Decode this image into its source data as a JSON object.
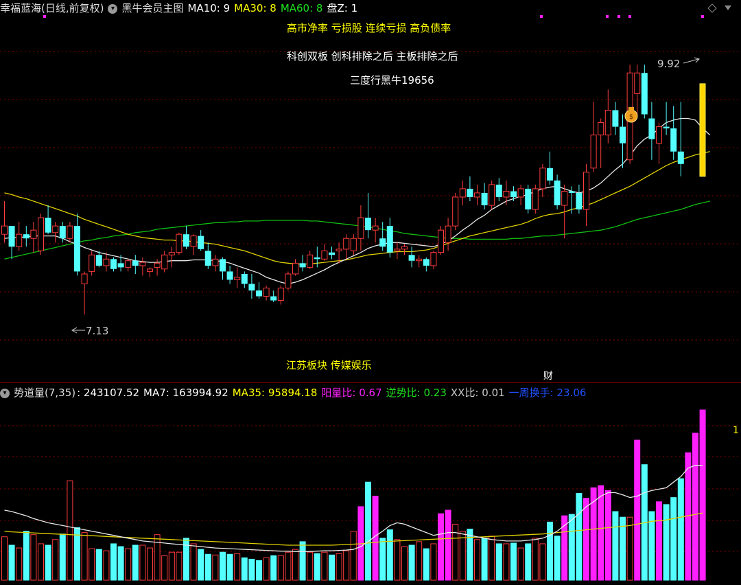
{
  "header_main": {
    "title": "幸福蓝海(日线,前复权)",
    "indicator_name": "黑牛会员主图",
    "ma10": "MA10: 9",
    "ma30": "MA30: 8",
    "ma60": "MA60: 8",
    "panz": "盘Z: 1"
  },
  "header_vol": {
    "title": "势道量(7,35)",
    "value": ": 243107.52",
    "ma7": "MA7: 163994.92",
    "ma35": "MA35: 95894.18",
    "yang": "阳量比: 0.67",
    "nishi": "逆势比: 0.23",
    "xx": "XX比: 0.01",
    "turnover": "一周换手: 23.06"
  },
  "annotations": {
    "line1": "高市净率 亏损股 连续亏损 高负债率",
    "line2": "科创双板 创科排除之后 主板排除之后",
    "line3": "三度行黑牛19656",
    "sector": "江苏板块 传媒娱乐",
    "cai": "财",
    "high_label": "9.92",
    "low_label": "7.13",
    "vol_axis": "1"
  },
  "colors": {
    "up": "#ff3c3c",
    "down": "#54ffff",
    "ma_white": "#e8e8e8",
    "ma_yellow": "#e0d000",
    "ma_green": "#10c010",
    "vol_magenta": "#ff20ff",
    "grid": "#8a0000",
    "highlight": "#ffd700"
  },
  "icons": [
    "chevron-down-icon",
    "money-bag-icon",
    "diamond-icon"
  ],
  "chart_data": [
    {
      "type": "candlestick",
      "title": "幸福蓝海(日线,前复权)",
      "ylim": [
        6.35,
        10.6
      ],
      "candles": [
        [
          8.1,
          8.5,
          8.0,
          8.2
        ],
        [
          8.2,
          8.2,
          7.8,
          7.95
        ],
        [
          7.95,
          8.25,
          7.9,
          8.1
        ],
        [
          8.1,
          8.2,
          7.95,
          8.05
        ],
        [
          8.05,
          8.25,
          7.88,
          8.15
        ],
        [
          7.9,
          8.35,
          7.85,
          8.3
        ],
        [
          8.3,
          8.45,
          8.1,
          8.12
        ],
        [
          8.12,
          8.25,
          8.0,
          8.2
        ],
        [
          8.2,
          8.25,
          8.0,
          8.05
        ],
        [
          8.05,
          8.25,
          8.0,
          8.2
        ],
        [
          8.2,
          8.35,
          7.6,
          7.65
        ],
        [
          7.5,
          7.65,
          7.13,
          7.62
        ],
        [
          7.65,
          7.9,
          7.6,
          7.85
        ],
        [
          7.85,
          7.9,
          7.7,
          7.72
        ],
        [
          7.72,
          7.88,
          7.65,
          7.8
        ],
        [
          7.8,
          7.82,
          7.65,
          7.68
        ],
        [
          7.75,
          7.85,
          7.65,
          7.7
        ],
        [
          7.7,
          7.8,
          7.65,
          7.78
        ],
        [
          7.78,
          7.85,
          7.62,
          7.72
        ],
        [
          7.72,
          7.82,
          7.6,
          7.76
        ],
        [
          7.65,
          7.7,
          7.58,
          7.68
        ],
        [
          7.7,
          7.8,
          7.6,
          7.75
        ],
        [
          7.68,
          7.9,
          7.64,
          7.85
        ],
        [
          7.85,
          7.95,
          7.7,
          7.88
        ],
        [
          7.88,
          8.12,
          7.85,
          8.1
        ],
        [
          8.1,
          8.2,
          7.92,
          7.95
        ],
        [
          7.95,
          8.1,
          7.85,
          8.08
        ],
        [
          8.08,
          8.15,
          7.9,
          7.92
        ],
        [
          7.9,
          8.0,
          7.68,
          7.72
        ],
        [
          7.72,
          7.85,
          7.65,
          7.8
        ],
        [
          7.8,
          7.82,
          7.55,
          7.65
        ],
        [
          7.65,
          7.72,
          7.5,
          7.55
        ],
        [
          7.55,
          7.7,
          7.45,
          7.58
        ],
        [
          7.62,
          7.65,
          7.45,
          7.5
        ],
        [
          7.5,
          7.62,
          7.32,
          7.42
        ],
        [
          7.42,
          7.52,
          7.32,
          7.35
        ],
        [
          7.35,
          7.48,
          7.3,
          7.45
        ],
        [
          7.35,
          7.42,
          7.28,
          7.3
        ],
        [
          7.3,
          7.48,
          7.25,
          7.45
        ],
        [
          7.45,
          7.65,
          7.42,
          7.62
        ],
        [
          7.62,
          7.8,
          7.6,
          7.75
        ],
        [
          7.75,
          7.85,
          7.65,
          7.7
        ],
        [
          7.7,
          7.9,
          7.68,
          7.85
        ],
        [
          7.82,
          7.95,
          7.7,
          7.8
        ],
        [
          7.8,
          7.98,
          7.78,
          7.9
        ],
        [
          7.88,
          7.95,
          7.8,
          7.85
        ],
        [
          7.9,
          8.0,
          7.75,
          7.92
        ],
        [
          7.92,
          8.1,
          7.8,
          8.05
        ],
        [
          7.9,
          8.1,
          7.85,
          8.05
        ],
        [
          8.05,
          8.45,
          7.9,
          8.3
        ],
        [
          8.3,
          8.6,
          8.05,
          8.15
        ],
        [
          8.15,
          8.3,
          8.0,
          8.2
        ],
        [
          8.05,
          8.25,
          7.9,
          7.95
        ],
        [
          8.2,
          8.3,
          7.82,
          7.88
        ],
        [
          7.9,
          8.0,
          7.8,
          7.92
        ],
        [
          7.92,
          7.98,
          7.85,
          7.95
        ],
        [
          7.85,
          7.95,
          7.7,
          7.78
        ],
        [
          7.78,
          7.85,
          7.7,
          7.8
        ],
        [
          7.8,
          7.82,
          7.65,
          7.72
        ],
        [
          7.72,
          7.9,
          7.68,
          7.88
        ],
        [
          7.88,
          8.2,
          7.85,
          8.15
        ],
        [
          8.0,
          8.3,
          7.9,
          8.2
        ],
        [
          8.2,
          8.6,
          8.15,
          8.55
        ],
        [
          8.55,
          8.75,
          8.45,
          8.65
        ],
        [
          8.65,
          8.8,
          8.5,
          8.55
        ],
        [
          8.55,
          8.7,
          8.45,
          8.6
        ],
        [
          8.6,
          8.72,
          8.4,
          8.45
        ],
        [
          8.45,
          8.75,
          8.4,
          8.7
        ],
        [
          8.7,
          8.78,
          8.5,
          8.55
        ],
        [
          8.55,
          8.75,
          8.45,
          8.62
        ],
        [
          8.62,
          8.68,
          8.5,
          8.55
        ],
        [
          8.55,
          8.7,
          8.45,
          8.65
        ],
        [
          8.65,
          8.7,
          8.35,
          8.4
        ],
        [
          8.4,
          8.7,
          8.35,
          8.65
        ],
        [
          8.65,
          8.95,
          8.55,
          8.9
        ],
        [
          8.9,
          9.1,
          8.7,
          8.75
        ],
        [
          8.75,
          8.82,
          8.4,
          8.45
        ],
        [
          8.45,
          8.7,
          8.05,
          8.62
        ],
        [
          8.62,
          8.68,
          8.35,
          8.6
        ],
        [
          8.6,
          8.7,
          8.35,
          8.4
        ],
        [
          8.4,
          8.95,
          8.2,
          8.85
        ],
        [
          8.9,
          9.7,
          8.85,
          9.3
        ],
        [
          9.3,
          9.5,
          8.9,
          9.45
        ],
        [
          9.3,
          9.85,
          9.2,
          9.6
        ],
        [
          9.6,
          9.7,
          9.3,
          9.4
        ],
        [
          9.4,
          9.55,
          8.9,
          9.2
        ],
        [
          9.0,
          10.15,
          8.95,
          10.05
        ],
        [
          9.8,
          10.15,
          9.5,
          10.05
        ],
        [
          10.05,
          10.15,
          9.5,
          9.55
        ],
        [
          9.5,
          9.7,
          9.0,
          9.25
        ],
        [
          9.2,
          9.45,
          8.95,
          9.4
        ],
        [
          9.4,
          9.7,
          9.3,
          9.38
        ],
        [
          9.38,
          9.65,
          9.0,
          9.1
        ],
        [
          9.1,
          9.7,
          8.8,
          8.95
        ]
      ],
      "ma10": [
        8.05,
        8.06,
        8.06,
        8.07,
        8.08,
        8.08,
        8.08,
        8.08,
        8.05,
        8.01,
        7.98,
        7.94,
        7.91,
        7.88,
        7.86,
        7.84,
        7.82,
        7.8,
        7.78,
        7.77,
        7.76,
        7.76,
        7.77,
        7.78,
        7.78,
        7.78,
        7.79,
        7.79,
        7.79,
        7.78,
        7.77,
        7.75,
        7.72,
        7.69,
        7.66,
        7.63,
        7.58,
        7.55,
        7.52,
        7.5,
        7.52,
        7.55,
        7.59,
        7.63,
        7.67,
        7.72,
        7.76,
        7.8,
        7.84,
        7.88,
        7.93,
        7.96,
        7.98,
        8.0,
        8.0,
        7.99,
        7.98,
        7.97,
        7.96,
        7.95,
        7.98,
        8.02,
        8.08,
        8.15,
        8.21,
        8.28,
        8.33,
        8.4,
        8.45,
        8.5,
        8.53,
        8.56,
        8.58,
        8.62,
        8.65,
        8.67,
        8.68,
        8.65,
        8.62,
        8.6,
        8.62,
        8.66,
        8.72,
        8.8,
        8.88,
        8.95,
        9.05,
        9.17,
        9.25,
        9.3,
        9.38,
        9.45,
        9.48,
        9.5,
        9.5,
        9.48,
        9.38,
        9.3
      ],
      "ma30": [
        8.6,
        8.58,
        8.55,
        8.53,
        8.5,
        8.47,
        8.44,
        8.41,
        8.38,
        8.35,
        8.32,
        8.28,
        8.25,
        8.22,
        8.19,
        8.16,
        8.13,
        8.1,
        8.08,
        8.06,
        8.05,
        8.04,
        8.03,
        8.03,
        8.02,
        8.02,
        8.01,
        8.0,
        7.99,
        7.98,
        7.96,
        7.94,
        7.92,
        7.9,
        7.87,
        7.84,
        7.81,
        7.78,
        7.76,
        7.75,
        7.74,
        7.74,
        7.74,
        7.75,
        7.76,
        7.77,
        7.78,
        7.79,
        7.81,
        7.83,
        7.85,
        7.86,
        7.87,
        7.88,
        7.89,
        7.89,
        7.89,
        7.9,
        7.91,
        7.93,
        7.96,
        7.99,
        8.02,
        8.05,
        8.08,
        8.1,
        8.12,
        8.14,
        8.16,
        8.18,
        8.2,
        8.22,
        8.25,
        8.29,
        8.32,
        8.34,
        8.35,
        8.37,
        8.4,
        8.42,
        8.45,
        8.48,
        8.52,
        8.56,
        8.6,
        8.64,
        8.68,
        8.73,
        8.78,
        8.83,
        8.88,
        8.93,
        8.97,
        9.0,
        9.03,
        9.06,
        9.08,
        9.1
      ],
      "ma60": [
        7.8,
        7.82,
        7.84,
        7.86,
        7.88,
        7.9,
        7.92,
        7.94,
        7.96,
        7.98,
        8.0,
        8.02,
        8.03,
        8.05,
        8.06,
        8.08,
        8.09,
        8.1,
        8.12,
        8.13,
        8.14,
        8.16,
        8.17,
        8.18,
        8.19,
        8.2,
        8.21,
        8.22,
        8.23,
        8.24,
        8.24,
        8.25,
        8.25,
        8.26,
        8.26,
        8.26,
        8.27,
        8.27,
        8.27,
        8.27,
        8.27,
        8.27,
        8.26,
        8.26,
        8.25,
        8.24,
        8.23,
        8.22,
        8.21,
        8.2,
        8.19,
        8.17,
        8.16,
        8.14,
        8.13,
        8.11,
        8.1,
        8.09,
        8.08,
        8.07,
        8.06,
        8.05,
        8.05,
        8.05,
        8.04,
        8.04,
        8.04,
        8.04,
        8.04,
        8.04,
        8.05,
        8.05,
        8.06,
        8.07,
        8.08,
        8.08,
        8.09,
        8.1,
        8.11,
        8.12,
        8.13,
        8.14,
        8.15,
        8.17,
        8.19,
        8.22,
        8.25,
        8.28,
        8.3,
        8.32,
        8.34,
        8.36,
        8.38,
        8.4,
        8.43,
        8.46,
        8.48,
        8.5
      ],
      "high_marker": 9.92,
      "low_marker": 7.13
    },
    {
      "type": "bar",
      "title": "势道量(7,35)",
      "ylim": [
        0,
        250000
      ],
      "values": [
        62000,
        50000,
        46000,
        70000,
        65000,
        52000,
        50000,
        58000,
        66000,
        142000,
        75000,
        68000,
        45000,
        44000,
        42000,
        52000,
        48000,
        45000,
        50000,
        50000,
        46000,
        65000,
        35000,
        40000,
        40000,
        60000,
        52000,
        44000,
        37000,
        36000,
        40000,
        37000,
        38000,
        32000,
        30000,
        28000,
        32000,
        35000,
        35000,
        40000,
        44000,
        55000,
        40000,
        38000,
        40000,
        36000,
        38000,
        42000,
        70000,
        105000,
        140000,
        120000,
        60000,
        72000,
        58000,
        48000,
        50000,
        55000,
        45000,
        52000,
        95000,
        100000,
        80000,
        70000,
        73000,
        58000,
        60000,
        63000,
        52000,
        52000,
        53000,
        46000,
        52000,
        60000,
        52000,
        83000,
        63000,
        92000,
        94000,
        124000,
        117000,
        132000,
        135000,
        128000,
        98000,
        90000,
        90000,
        200000,
        165000,
        98000,
        112000,
        108000,
        118000,
        145000,
        182000,
        210000,
        243107
      ],
      "ma7": [
        100000,
        98000,
        95000,
        92000,
        88000,
        85000,
        82000,
        80000,
        78000,
        76000,
        74000,
        72000,
        70000,
        68000,
        66000,
        64000,
        62000,
        60000,
        58000,
        56000,
        55000,
        54000,
        53000,
        52000,
        51000,
        50000,
        49000,
        48000,
        47000,
        46000,
        45500,
        45000,
        44500,
        44000,
        43500,
        43000,
        42500,
        42000,
        41500,
        41500,
        41000,
        41000,
        41000,
        41500,
        42000,
        42000,
        42500,
        43000,
        44000,
        48000,
        55000,
        63000,
        70000,
        78000,
        82000,
        80000,
        76000,
        72000,
        68000,
        64000,
        66000,
        68000,
        68000,
        66000,
        64000,
        62000,
        60000,
        58000,
        57000,
        56000,
        56000,
        56000,
        57000,
        58000,
        60000,
        64000,
        70000,
        78000,
        86000,
        95000,
        105000,
        112000,
        120000,
        125000,
        125000,
        122000,
        118000,
        120000,
        125000,
        128000,
        130000,
        132000,
        140000,
        148000,
        160000,
        163994,
        163994
      ],
      "ma35": [
        70000,
        69000,
        68500,
        68000,
        67500,
        67000,
        66500,
        66000,
        65500,
        65000,
        64500,
        64000,
        63500,
        63000,
        62500,
        62000,
        61500,
        61000,
        60500,
        60000,
        59500,
        59000,
        58500,
        58000,
        57500,
        57000,
        56500,
        56000,
        55500,
        55000,
        54500,
        54000,
        53500,
        53000,
        52500,
        52000,
        51500,
        51000,
        50500,
        50000,
        50000,
        50000,
        50000,
        50000,
        50000,
        50000,
        50500,
        51000,
        51500,
        52000,
        53000,
        54000,
        55000,
        55500,
        56000,
        56500,
        57000,
        57500,
        58000,
        58500,
        59000,
        59500,
        60000,
        60500,
        61000,
        61500,
        62000,
        62500,
        63000,
        63500,
        64000,
        64500,
        65000,
        65500,
        66000,
        67000,
        68000,
        69000,
        70000,
        71000,
        72000,
        73000,
        74000,
        75000,
        76000,
        77000,
        78000,
        80000,
        82000,
        84000,
        85000,
        86000,
        88000,
        90000,
        92000,
        94000,
        95894
      ]
    }
  ]
}
